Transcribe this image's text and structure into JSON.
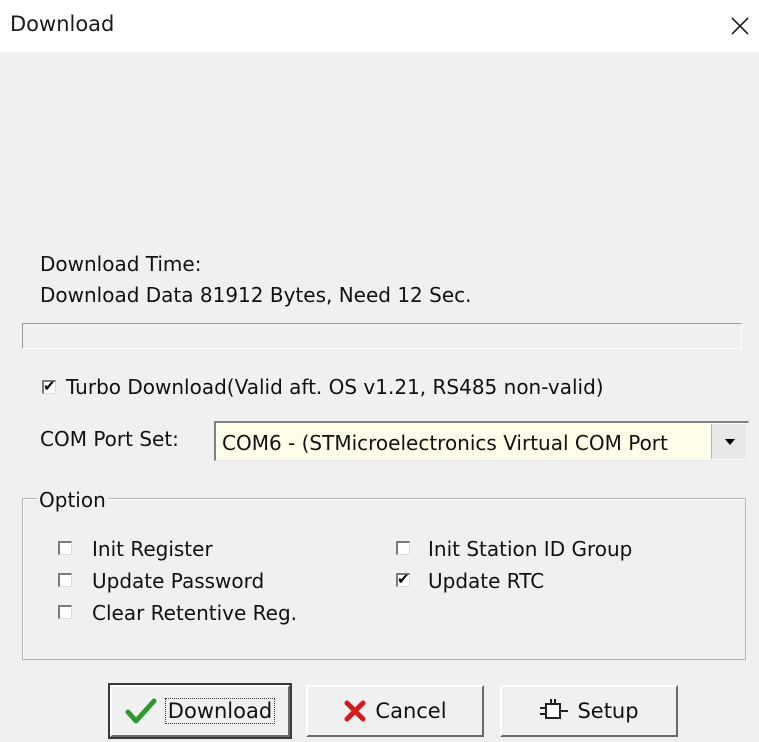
{
  "window": {
    "title": "Download",
    "close_icon": "close-icon"
  },
  "info": {
    "time_label": "Download Time:",
    "data_line": "Download Data 81912 Bytes, Need 12 Sec."
  },
  "progress": {
    "value": 0
  },
  "turbo": {
    "label": "Turbo Download(Valid aft. OS v1.21, RS485 non-valid)",
    "checked": true
  },
  "com_port": {
    "label": "COM Port Set:",
    "value": "COM6 - (STMicroelectronics Virtual COM Port"
  },
  "option": {
    "title": "Option",
    "items": [
      {
        "label": "Init Register",
        "checked": false
      },
      {
        "label": "Update Password",
        "checked": false
      },
      {
        "label": "Clear Retentive Reg.",
        "checked": false
      },
      {
        "label": "Init Station ID Group",
        "checked": false
      },
      {
        "label": "Update RTC",
        "checked": true
      }
    ]
  },
  "buttons": {
    "download": {
      "label": "Download",
      "icon": "checkmark-icon",
      "color": "#2e9a2e"
    },
    "cancel": {
      "label": "Cancel",
      "icon": "red-x-icon",
      "color": "#d21c1c"
    },
    "setup": {
      "label": "Setup",
      "icon": "settings-plug-icon"
    }
  }
}
